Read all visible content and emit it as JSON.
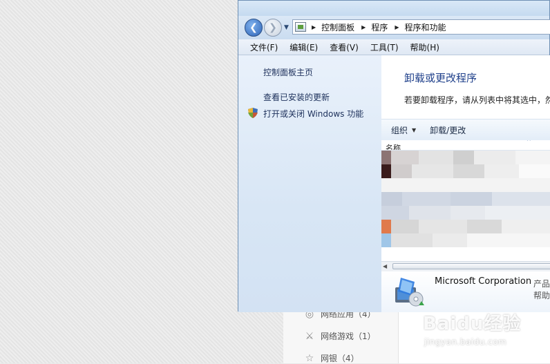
{
  "window": {
    "breadcrumbs": [
      "控制面板",
      "程序",
      "程序和功能"
    ]
  },
  "menubar": {
    "items": [
      "文件(F)",
      "编辑(E)",
      "查看(V)",
      "工具(T)",
      "帮助(H)"
    ]
  },
  "leftpane": {
    "home_link": "控制面板主页",
    "updates_link": "查看已安装的更新",
    "features_link": "打开或关闭 Windows 功能"
  },
  "content": {
    "title": "卸载或更改程序",
    "description": "若要卸载程序，请从列表中将其选中，然",
    "toolbar": {
      "organize": "组织",
      "uninstall": "卸载/更改"
    },
    "list_header": {
      "name": "名称"
    }
  },
  "details": {
    "publisher": "Microsoft Corporation",
    "publisher_label": "产品",
    "help_label": "帮助"
  },
  "background_app": {
    "items": [
      {
        "label": "网络应用（4）",
        "icon": "globe-icon"
      },
      {
        "label": "网络游戏（1）",
        "icon": "sword-icon"
      },
      {
        "label": "网银（4）",
        "icon": "star-icon"
      }
    ]
  },
  "watermark": {
    "logo": "Baidu经验",
    "url": "jingyan.baidu.com"
  },
  "colors": {
    "link": "#1c2f5a",
    "title": "#1e3f8a",
    "window_border": "#6e8fb3"
  }
}
